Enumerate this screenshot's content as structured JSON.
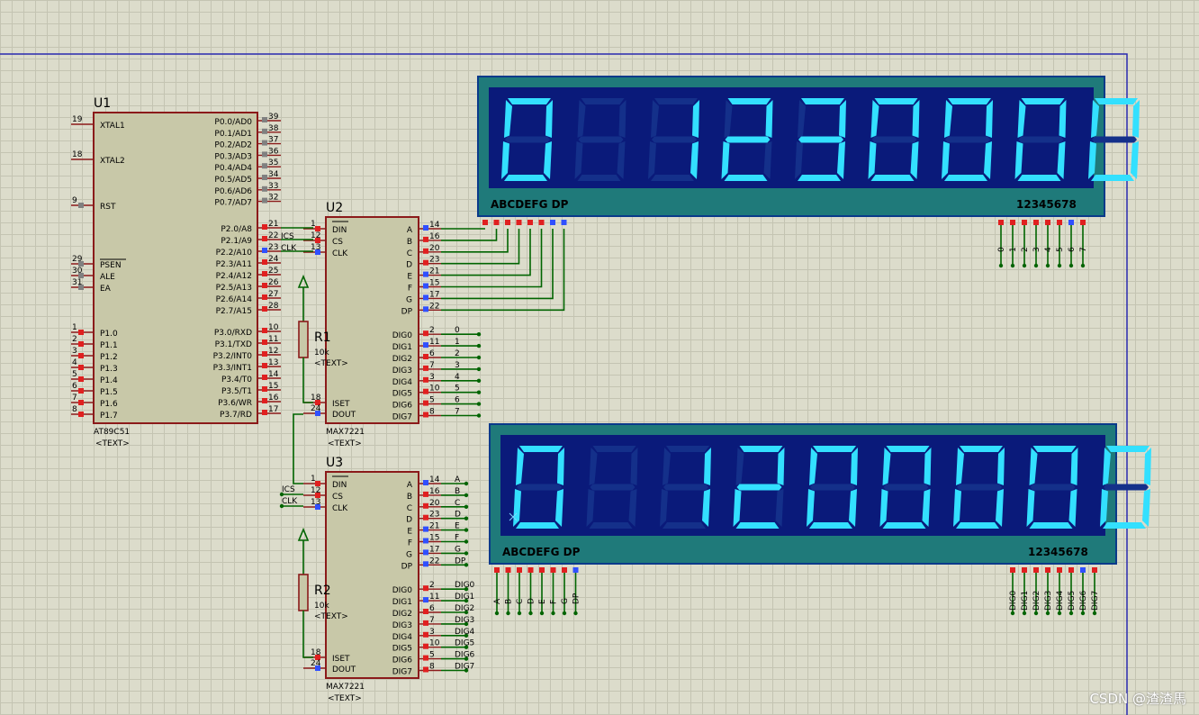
{
  "u1": {
    "ref": "U1",
    "part": "AT89C51",
    "text": "<TEXT>",
    "left_pins": [
      {
        "num": "19",
        "label": "XTAL1"
      },
      {
        "num": "18",
        "label": "XTAL2"
      },
      {
        "num": "9",
        "label": "RST"
      },
      {
        "num": "29",
        "label": "PSEN"
      },
      {
        "num": "30",
        "label": "ALE"
      },
      {
        "num": "31",
        "label": "EA"
      },
      {
        "num": "1",
        "label": "P1.0"
      },
      {
        "num": "2",
        "label": "P1.1"
      },
      {
        "num": "3",
        "label": "P1.2"
      },
      {
        "num": "4",
        "label": "P1.3"
      },
      {
        "num": "5",
        "label": "P1.4"
      },
      {
        "num": "6",
        "label": "P1.5"
      },
      {
        "num": "7",
        "label": "P1.6"
      },
      {
        "num": "8",
        "label": "P1.7"
      }
    ],
    "right_pins": [
      {
        "num": "39",
        "label": "P0.0/AD0"
      },
      {
        "num": "38",
        "label": "P0.1/AD1"
      },
      {
        "num": "37",
        "label": "P0.2/AD2"
      },
      {
        "num": "36",
        "label": "P0.3/AD3"
      },
      {
        "num": "35",
        "label": "P0.4/AD4"
      },
      {
        "num": "34",
        "label": "P0.5/AD5"
      },
      {
        "num": "33",
        "label": "P0.6/AD6"
      },
      {
        "num": "32",
        "label": "P0.7/AD7"
      },
      {
        "num": "21",
        "label": "P2.0/A8"
      },
      {
        "num": "22",
        "label": "P2.1/A9"
      },
      {
        "num": "23",
        "label": "P2.2/A10"
      },
      {
        "num": "24",
        "label": "P2.3/A11"
      },
      {
        "num": "25",
        "label": "P2.4/A12"
      },
      {
        "num": "26",
        "label": "P2.5/A13"
      },
      {
        "num": "27",
        "label": "P2.6/A14"
      },
      {
        "num": "28",
        "label": "P2.7/A15"
      },
      {
        "num": "10",
        "label": "P3.0/RXD"
      },
      {
        "num": "11",
        "label": "P3.1/TXD"
      },
      {
        "num": "12",
        "label": "P3.2/INT0"
      },
      {
        "num": "13",
        "label": "P3.3/INT1"
      },
      {
        "num": "14",
        "label": "P3.4/T0"
      },
      {
        "num": "15",
        "label": "P3.5/T1"
      },
      {
        "num": "16",
        "label": "P3.6/WR"
      },
      {
        "num": "17",
        "label": "P3.7/RD"
      }
    ],
    "nets": {
      "ics": "ICS",
      "clk": "CLK"
    }
  },
  "u2": {
    "ref": "U2",
    "part": "MAX7221",
    "text": "<TEXT>",
    "left_pins": [
      {
        "num": "1",
        "label": "DIN"
      },
      {
        "num": "12",
        "label": "CS"
      },
      {
        "num": "13",
        "label": "CLK"
      },
      {
        "num": "18",
        "label": "ISET"
      },
      {
        "num": "24",
        "label": "DOUT"
      }
    ],
    "right_pins": [
      {
        "num": "14",
        "label": "A"
      },
      {
        "num": "16",
        "label": "B"
      },
      {
        "num": "20",
        "label": "C"
      },
      {
        "num": "23",
        "label": "D"
      },
      {
        "num": "21",
        "label": "E"
      },
      {
        "num": "15",
        "label": "F"
      },
      {
        "num": "17",
        "label": "G"
      },
      {
        "num": "22",
        "label": "DP"
      },
      {
        "num": "2",
        "label": "DIG0",
        "net": "0"
      },
      {
        "num": "11",
        "label": "DIG1",
        "net": "1"
      },
      {
        "num": "6",
        "label": "DIG2",
        "net": "2"
      },
      {
        "num": "7",
        "label": "DIG3",
        "net": "3"
      },
      {
        "num": "3",
        "label": "DIG4",
        "net": "4"
      },
      {
        "num": "10",
        "label": "DIG5",
        "net": "5"
      },
      {
        "num": "5",
        "label": "DIG6",
        "net": "6"
      },
      {
        "num": "8",
        "label": "DIG7",
        "net": "7"
      }
    ]
  },
  "u3": {
    "ref": "U3",
    "part": "MAX7221",
    "text": "<TEXT>",
    "left_pins": [
      {
        "num": "1",
        "label": "DIN"
      },
      {
        "num": "12",
        "label": "CS"
      },
      {
        "num": "13",
        "label": "CLK"
      },
      {
        "num": "18",
        "label": "ISET"
      },
      {
        "num": "24",
        "label": "DOUT"
      }
    ],
    "left_nets": {
      "ics": "ICS",
      "clk": "CLK"
    },
    "right_pins": [
      {
        "num": "14",
        "label": "A",
        "net": "A"
      },
      {
        "num": "16",
        "label": "B",
        "net": "B"
      },
      {
        "num": "20",
        "label": "C",
        "net": "C"
      },
      {
        "num": "23",
        "label": "D",
        "net": "D"
      },
      {
        "num": "21",
        "label": "E",
        "net": "E"
      },
      {
        "num": "15",
        "label": "F",
        "net": "F"
      },
      {
        "num": "17",
        "label": "G",
        "net": "G"
      },
      {
        "num": "22",
        "label": "DP",
        "net": "DP"
      },
      {
        "num": "2",
        "label": "DIG0",
        "net": "DIG0"
      },
      {
        "num": "11",
        "label": "DIG1",
        "net": "DIG1"
      },
      {
        "num": "6",
        "label": "DIG2",
        "net": "DIG2"
      },
      {
        "num": "7",
        "label": "DIG3",
        "net": "DIG3"
      },
      {
        "num": "3",
        "label": "DIG4",
        "net": "DIG4"
      },
      {
        "num": "10",
        "label": "DIG5",
        "net": "DIG5"
      },
      {
        "num": "5",
        "label": "DIG6",
        "net": "DIG6"
      },
      {
        "num": "8",
        "label": "DIG7",
        "net": "DIG7"
      }
    ]
  },
  "r1": {
    "ref": "R1",
    "value": "10k",
    "text": "<TEXT>"
  },
  "r2": {
    "ref": "R2",
    "value": "10k",
    "text": "<TEXT>"
  },
  "display1": {
    "digits": [
      "0",
      "",
      "1",
      "2",
      "3",
      "0",
      "0",
      "0",
      "0"
    ],
    "seg_label": "ABCDEFG  DP",
    "dig_label": "12345678",
    "dig_nets": [
      "0",
      "1",
      "2",
      "3",
      "4",
      "5",
      "6",
      "7"
    ]
  },
  "display2": {
    "digits": [
      "0",
      "",
      "1",
      "2",
      "0",
      "0",
      "0",
      "0",
      "0"
    ],
    "seg_label": "ABCDEFG  DP",
    "dig_label": "12345678",
    "seg_nets": [
      "A",
      "B",
      "C",
      "D",
      "E",
      "F",
      "G",
      "DP"
    ],
    "dig_nets": [
      "DIG0",
      "DIG1",
      "DIG2",
      "DIG3",
      "DIG4",
      "DIG5",
      "DIG6",
      "DIG7"
    ]
  },
  "colors": {
    "wire": "#006400",
    "chip_fill": "#c8c8a8",
    "chip_border": "#8b1a1a",
    "lcd_bg": "#0a1a7a",
    "lcd_frame": "#1f7a7a",
    "seg_on": "#33e0ff",
    "seg_off": "#14308a",
    "pin_red": "#e02020",
    "pin_blue": "#3050ff"
  },
  "watermark": "CSDN @渣渣馬"
}
